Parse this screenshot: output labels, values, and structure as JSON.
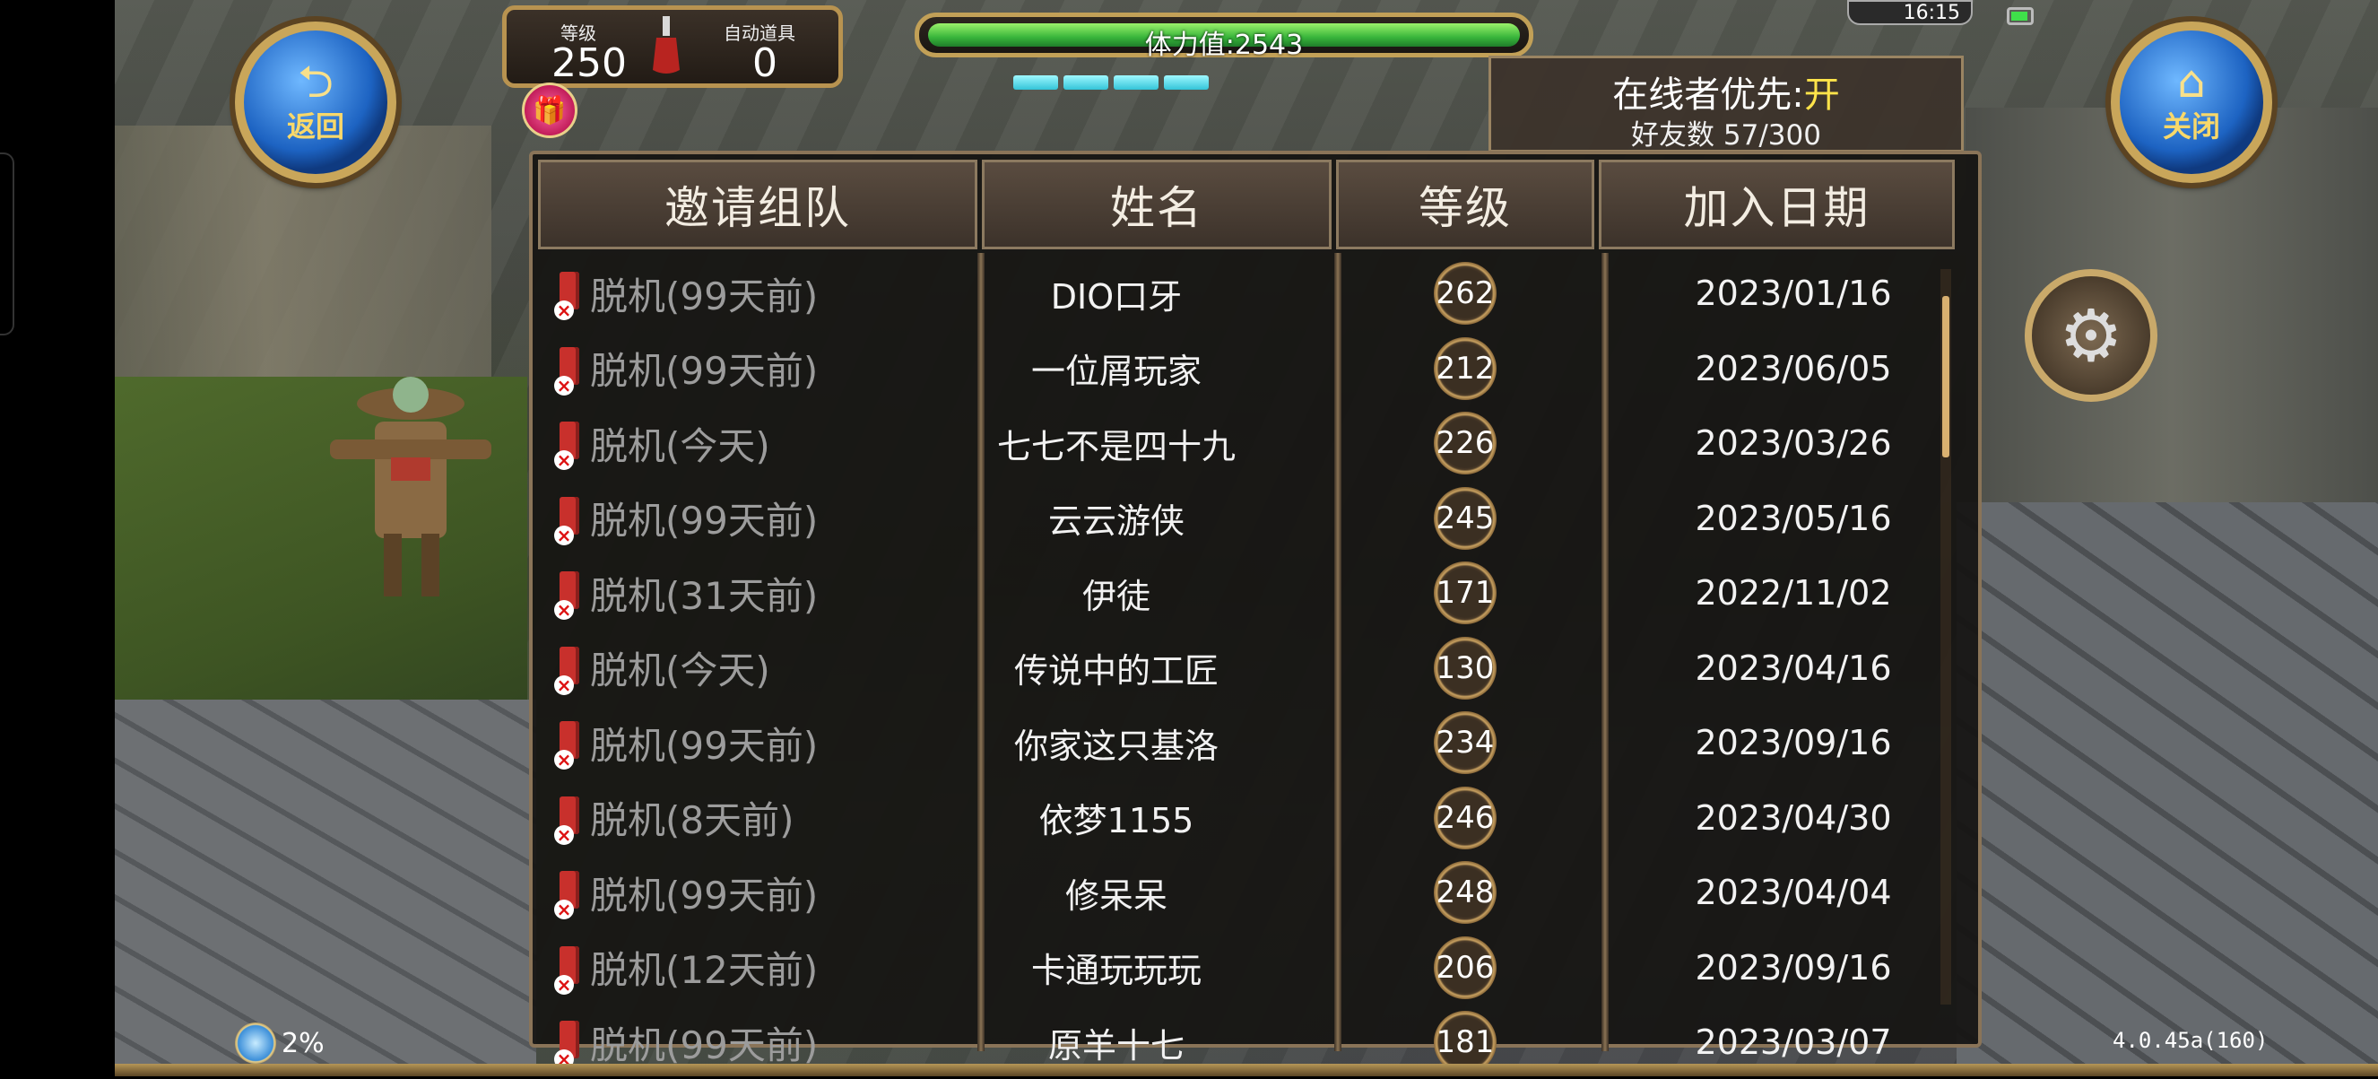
{
  "top_left": {
    "back_label": "返回",
    "level_key": "等级",
    "level_value": "250",
    "auto_item_key": "自动道具",
    "auto_item_value": "0"
  },
  "stamina": {
    "label": "体力值:2543"
  },
  "online_priority": {
    "label": "在线者优先:",
    "state": "开",
    "friends": "好友数 57/300"
  },
  "status_bar": {
    "time": "16:15"
  },
  "close_label": "关闭",
  "table": {
    "headers": [
      "邀请组队",
      "姓名",
      "等级",
      "加入日期"
    ],
    "rows": [
      {
        "status": "脱机(99天前)",
        "name": "DIO口牙",
        "level": "262",
        "date": "2023/01/16"
      },
      {
        "status": "脱机(99天前)",
        "name": "一位屑玩家",
        "level": "212",
        "date": "2023/06/05"
      },
      {
        "status": "脱机(今天)",
        "name": "七七不是四十九",
        "level": "226",
        "date": "2023/03/26"
      },
      {
        "status": "脱机(99天前)",
        "name": "云云游侠",
        "level": "245",
        "date": "2023/05/16"
      },
      {
        "status": "脱机(31天前)",
        "name": "伊徒",
        "level": "171",
        "date": "2022/11/02"
      },
      {
        "status": "脱机(今天)",
        "name": "传说中的工匠",
        "level": "130",
        "date": "2023/04/16"
      },
      {
        "status": "脱机(99天前)",
        "name": "你家这只基洛",
        "level": "234",
        "date": "2023/09/16"
      },
      {
        "status": "脱机(8天前)",
        "name": "依梦1155",
        "level": "246",
        "date": "2023/04/30"
      },
      {
        "status": "脱机(99天前)",
        "name": "修呆呆",
        "level": "248",
        "date": "2023/04/04"
      },
      {
        "status": "脱机(12天前)",
        "name": "卡通玩玩玩",
        "level": "206",
        "date": "2023/09/16"
      },
      {
        "status": "脱机(99天前)",
        "name": "原羊十七",
        "level": "181",
        "date": "2023/03/07"
      }
    ]
  },
  "footer": {
    "percent": "2%",
    "version": "4.0.45a(160)"
  },
  "icons": {
    "back": "back-arrow-icon",
    "close": "home-icon",
    "settings": "gear-icon",
    "offline": "offline-phone-icon"
  }
}
